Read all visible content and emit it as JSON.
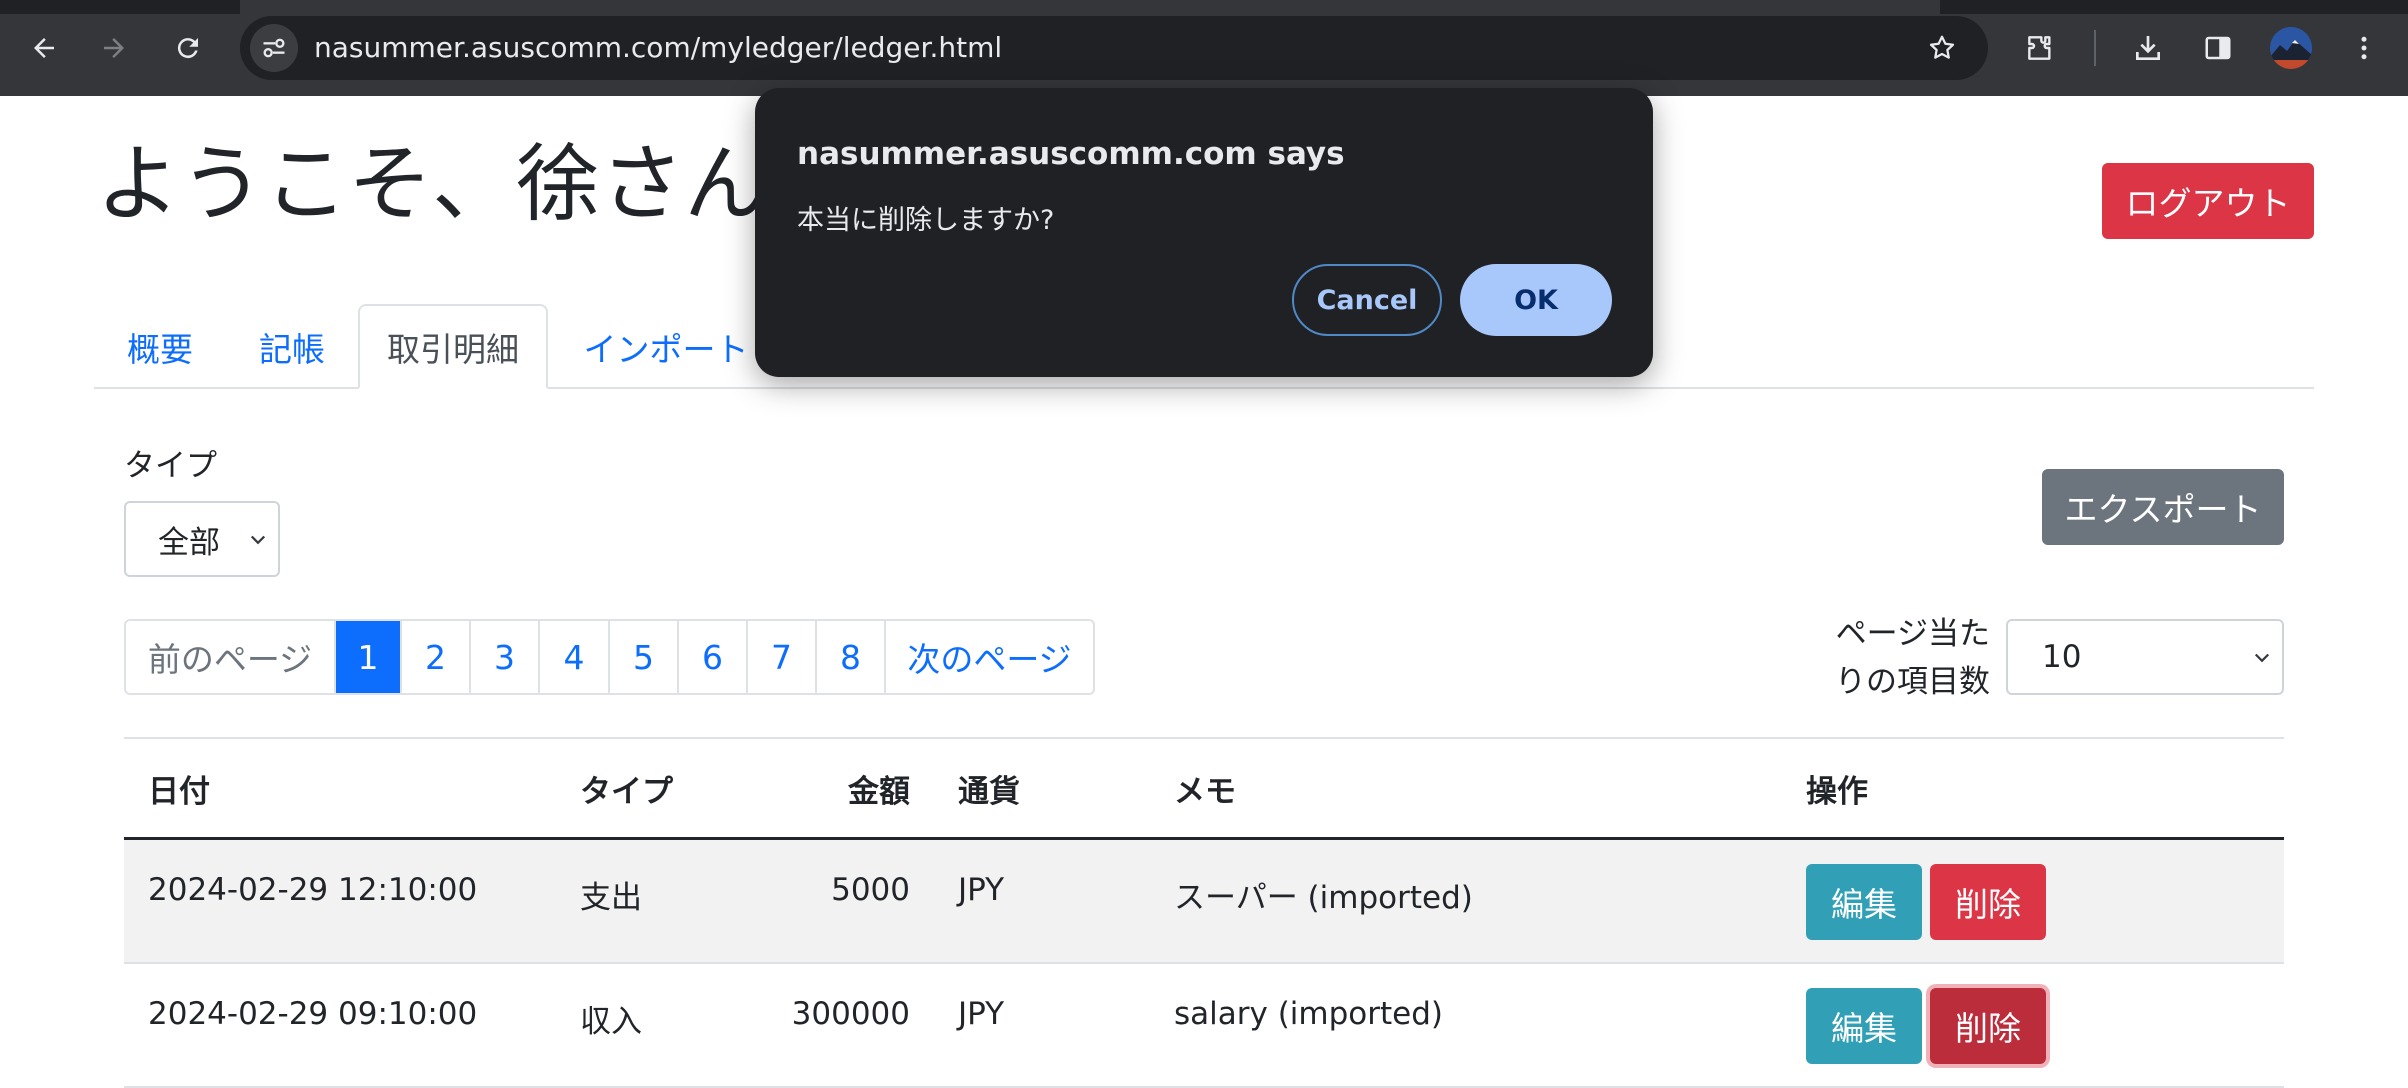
{
  "browser": {
    "url": "nasummer.asuscomm.com/myledger/ledger.html"
  },
  "header": {
    "welcome": "ようこそ、徐さん",
    "logout_label": "ログアウト"
  },
  "tabs": [
    {
      "label": "概要"
    },
    {
      "label": "記帳"
    },
    {
      "label": "取引明細",
      "active": true
    },
    {
      "label": "インポート"
    }
  ],
  "filter": {
    "type_label": "タイプ",
    "type_value": "全部",
    "export_label": "エクスポート"
  },
  "pagination": {
    "prev": "前のページ",
    "pages": [
      "1",
      "2",
      "3",
      "4",
      "5",
      "6",
      "7",
      "8"
    ],
    "current": "1",
    "next": "次のページ"
  },
  "per_page": {
    "label_line1": "ページ当た",
    "label_line2": "りの項目数",
    "value": "10"
  },
  "table": {
    "headers": {
      "date": "日付",
      "type": "タイプ",
      "amount": "金額",
      "currency": "通貨",
      "memo": "メモ",
      "actions": "操作"
    },
    "rows": [
      {
        "date": "2024-02-29 12:10:00",
        "type": "支出",
        "amount": "5000",
        "currency": "JPY",
        "memo": "スーパー (imported)",
        "edit": "編集",
        "delete": "削除"
      },
      {
        "date": "2024-02-29 09:10:00",
        "type": "収入",
        "amount": "300000",
        "currency": "JPY",
        "memo": "salary (imported)",
        "edit": "編集",
        "delete": "削除"
      }
    ]
  },
  "dialog": {
    "title": "nasummer.asuscomm.com says",
    "message": "本当に削除しますか?",
    "cancel_label": "Cancel",
    "ok_label": "OK"
  }
}
